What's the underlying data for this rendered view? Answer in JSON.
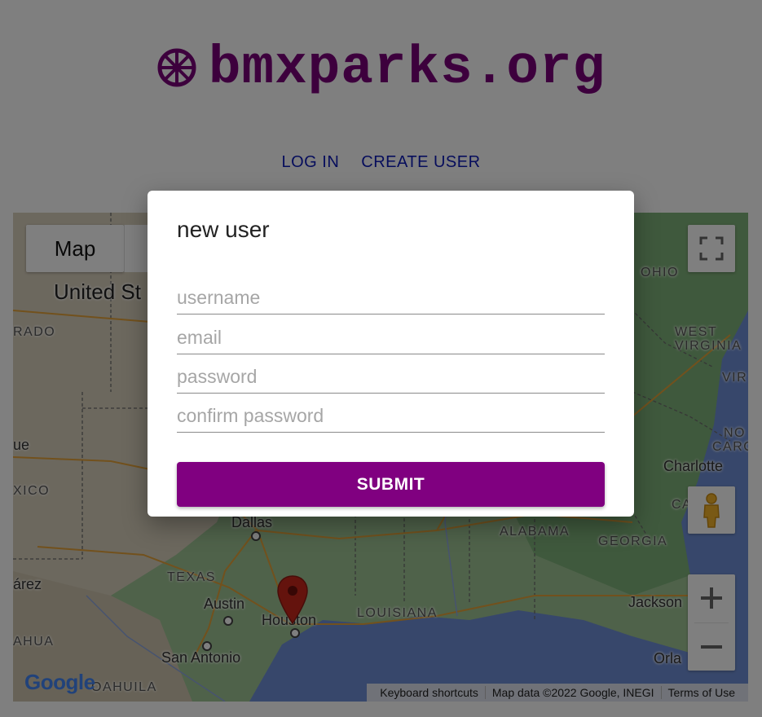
{
  "header": {
    "logo_text": "bmxparks.org",
    "logo_color": "#7a007a",
    "nav": {
      "login_label": "LOG IN",
      "create_user_label": "CREATE USER"
    }
  },
  "map": {
    "map_type_label": "Map",
    "labels": {
      "country": "United St",
      "rado": "RADO",
      "ue": "ue",
      "xico": "XICO",
      "arez": "árez",
      "ahua": "AHUA",
      "coahuila": "OAHUILA",
      "dallas": "Dallas",
      "texas": "TEXAS",
      "austin": "Austin",
      "houston": "Houston",
      "san_antonio": "San Antonio",
      "louisiana": "LOUISIANA",
      "alabama": "ALABAMA",
      "georgia": "GEORGIA",
      "charlotte": "Charlotte",
      "jackson": "Jackson",
      "orla": "Orla",
      "ohio": "OHIO",
      "west_virginia_1": "WEST",
      "west_virginia_2": "VIRGINIA",
      "vir": "VIR",
      "no": "NO",
      "car": "CARO",
      "ca": "CA"
    },
    "attribution": {
      "shortcuts": "Keyboard shortcuts",
      "data": "Map data ©2022 Google, INEGI",
      "terms": "Terms of Use"
    },
    "google_logo": "Google"
  },
  "dialog": {
    "title": "new user",
    "fields": {
      "username_placeholder": "username",
      "email_placeholder": "email",
      "password_placeholder": "password",
      "confirm_placeholder": "confirm password"
    },
    "submit_label": "SUBMIT",
    "submit_color": "#800080"
  }
}
